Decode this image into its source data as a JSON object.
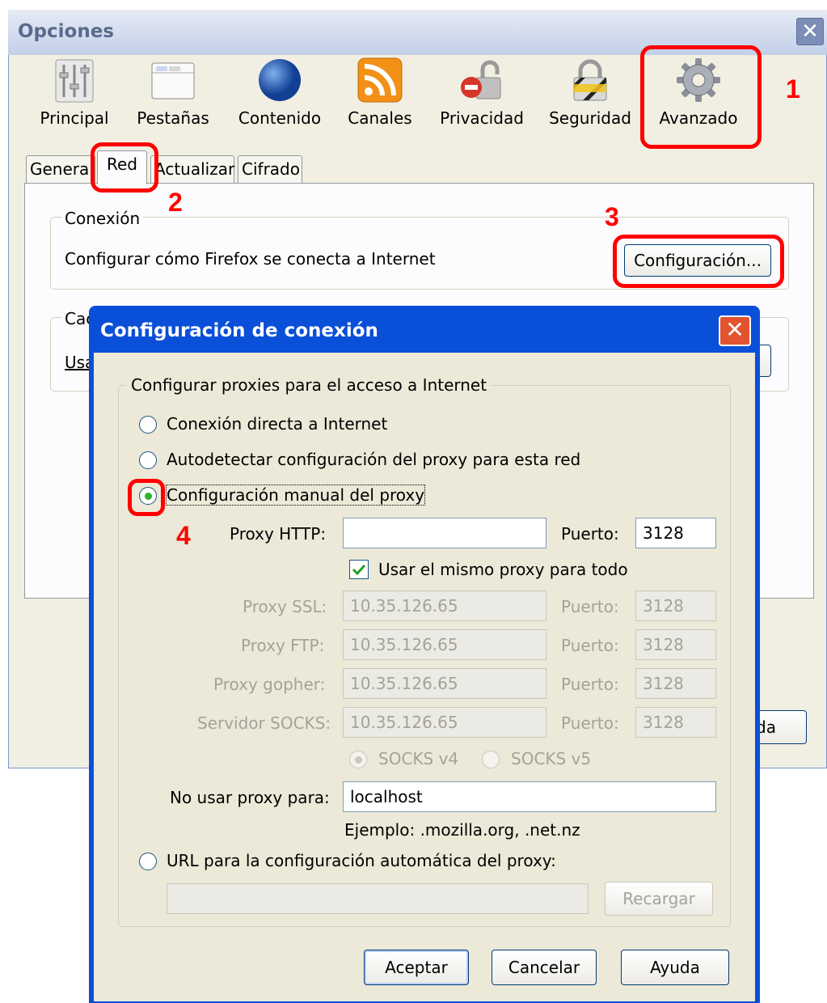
{
  "options_window": {
    "title": "Opciones",
    "toolbar": [
      {
        "label": "Principal",
        "icon": "sliders-icon"
      },
      {
        "label": "Pestañas",
        "icon": "tabs-window-icon"
      },
      {
        "label": "Contenido",
        "icon": "globe-icon"
      },
      {
        "label": "Canales",
        "icon": "rss-feed-icon"
      },
      {
        "label": "Privacidad",
        "icon": "lock-forbidden-icon"
      },
      {
        "label": "Seguridad",
        "icon": "padlock-icon"
      },
      {
        "label": "Avanzado",
        "icon": "gear-icon",
        "selected": true
      }
    ],
    "tabs": [
      {
        "label": "General"
      },
      {
        "label": "Red",
        "selected": true
      },
      {
        "label": "Actualizar"
      },
      {
        "label": "Cifrado"
      }
    ],
    "connection": {
      "legend": "Conexión",
      "description": "Configurar cómo Firefox se conecta a Internet",
      "button": "Configuración..."
    },
    "cache": {
      "legend_partial": "Cac",
      "text_partial": "Usa"
    },
    "partial_button": "da"
  },
  "annotations": {
    "color": "#ff0000",
    "numbers": [
      "1",
      "2",
      "3",
      "4"
    ]
  },
  "dialog": {
    "title": "Configuración de conexión",
    "group_legend": "Configurar proxies para el acceso a Internet",
    "radios": {
      "direct": "Conexión directa a Internet",
      "autodetect": "Autodetectar configuración del proxy para esta red",
      "manual": "Configuración manual del proxy",
      "auto_url": "URL para la configuración automática del proxy:"
    },
    "selected_radio": "manual",
    "http": {
      "label": "Proxy HTTP:",
      "value": "",
      "port_label": "Puerto:",
      "port": "3128"
    },
    "same_proxy": {
      "label": "Usar el mismo proxy para todo",
      "checked": true
    },
    "ssl": {
      "label": "Proxy SSL:",
      "value": "10.35.126.65",
      "port_label": "Puerto:",
      "port": "3128"
    },
    "ftp": {
      "label": "Proxy FTP:",
      "value": "10.35.126.65",
      "port_label": "Puerto:",
      "port": "3128"
    },
    "gopher": {
      "label": "Proxy gopher:",
      "value": "10.35.126.65",
      "port_label": "Puerto:",
      "port": "3128"
    },
    "socks": {
      "label": "Servidor SOCKS:",
      "value": "10.35.126.65",
      "port_label": "Puerto:",
      "port": "3128"
    },
    "socks_version": {
      "v4": "SOCKS v4",
      "v5": "SOCKS v5",
      "selected": "v4"
    },
    "no_proxy": {
      "label": "No usar proxy para:",
      "value": "localhost",
      "example": "Ejemplo: .mozilla.org, .net.nz"
    },
    "auto_url_value": "",
    "reload_button": "Recargar",
    "buttons": {
      "accept": "Aceptar",
      "cancel": "Cancelar",
      "help": "Ayuda"
    }
  }
}
